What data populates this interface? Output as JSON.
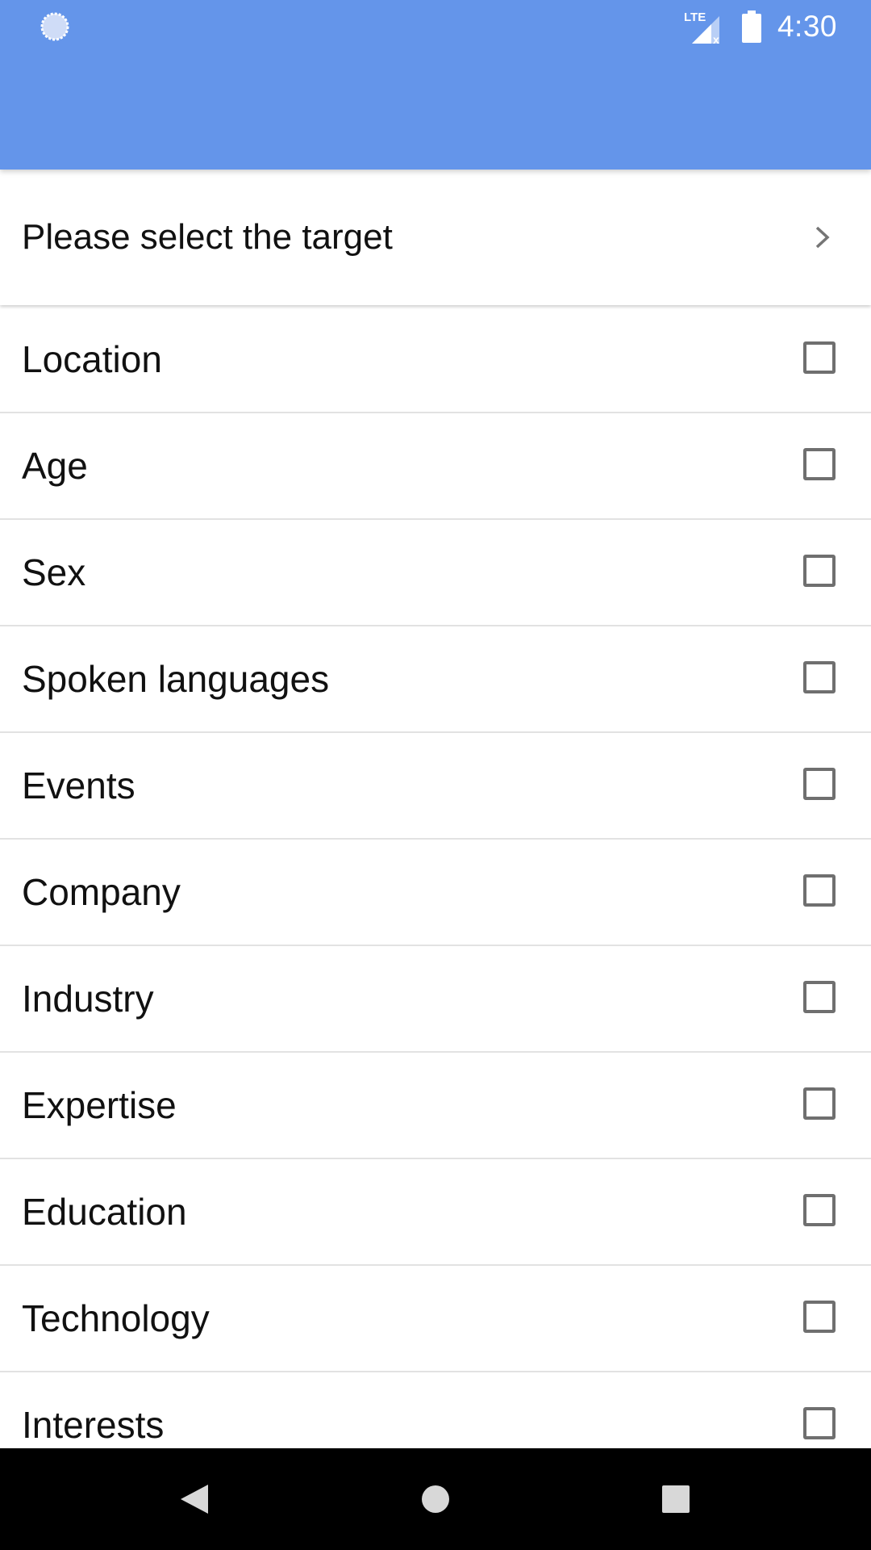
{
  "status_bar": {
    "time": "4:30",
    "network_label": "LTE",
    "icons": [
      "sync-icon",
      "signal-icon",
      "battery-icon"
    ]
  },
  "colors": {
    "app_bar": "#6495ea",
    "checkbox_border": "#6f6f6f",
    "divider": "#e2e2e2",
    "text": "#111111"
  },
  "target": {
    "label": "Please select the target",
    "icon": "chevron-right-icon"
  },
  "options": [
    {
      "label": "Location",
      "checked": false
    },
    {
      "label": "Age",
      "checked": false
    },
    {
      "label": "Sex",
      "checked": false
    },
    {
      "label": "Spoken languages",
      "checked": false
    },
    {
      "label": "Events",
      "checked": false
    },
    {
      "label": "Company",
      "checked": false
    },
    {
      "label": "Industry",
      "checked": false
    },
    {
      "label": "Expertise",
      "checked": false
    },
    {
      "label": "Education",
      "checked": false
    },
    {
      "label": "Technology",
      "checked": false
    },
    {
      "label": "Interests",
      "checked": false
    }
  ],
  "nav_bar": {
    "buttons": [
      "back-icon",
      "home-icon",
      "recents-icon"
    ]
  }
}
